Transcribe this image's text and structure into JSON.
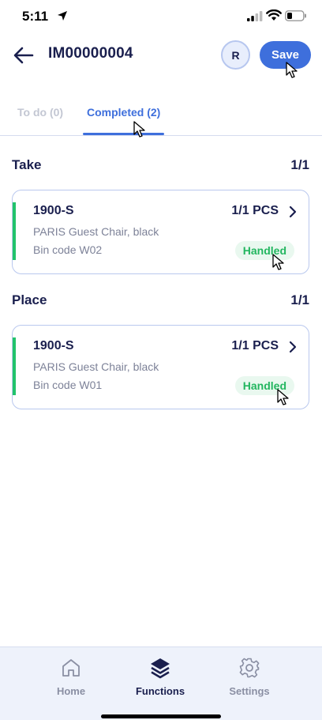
{
  "status_bar": {
    "time": "5:11"
  },
  "header": {
    "title": "IM00000004",
    "avatar_initial": "R",
    "save_label": "Save"
  },
  "tabs": [
    {
      "label": "To do (0)",
      "active": false
    },
    {
      "label": "Completed (2)",
      "active": true
    }
  ],
  "sections": [
    {
      "title": "Take",
      "count": "1/1",
      "card": {
        "item_code": "1900-S",
        "quantity": "1/1 PCS",
        "description": "PARIS Guest Chair, black",
        "bin": "Bin code W02",
        "status": "Handled"
      }
    },
    {
      "title": "Place",
      "count": "1/1",
      "card": {
        "item_code": "1900-S",
        "quantity": "1/1 PCS",
        "description": "PARIS Guest Chair, black",
        "bin": "Bin code W01",
        "status": "Handled"
      }
    }
  ],
  "bottom_nav": [
    {
      "label": "Home",
      "icon": "home-icon",
      "active": false
    },
    {
      "label": "Functions",
      "icon": "layers-icon",
      "active": true
    },
    {
      "label": "Settings",
      "icon": "gear-icon",
      "active": false
    }
  ],
  "colors": {
    "accent": "#3e6fdc",
    "navy": "#1a1f4e",
    "success": "#22c36b",
    "muted": "#7d8298"
  }
}
